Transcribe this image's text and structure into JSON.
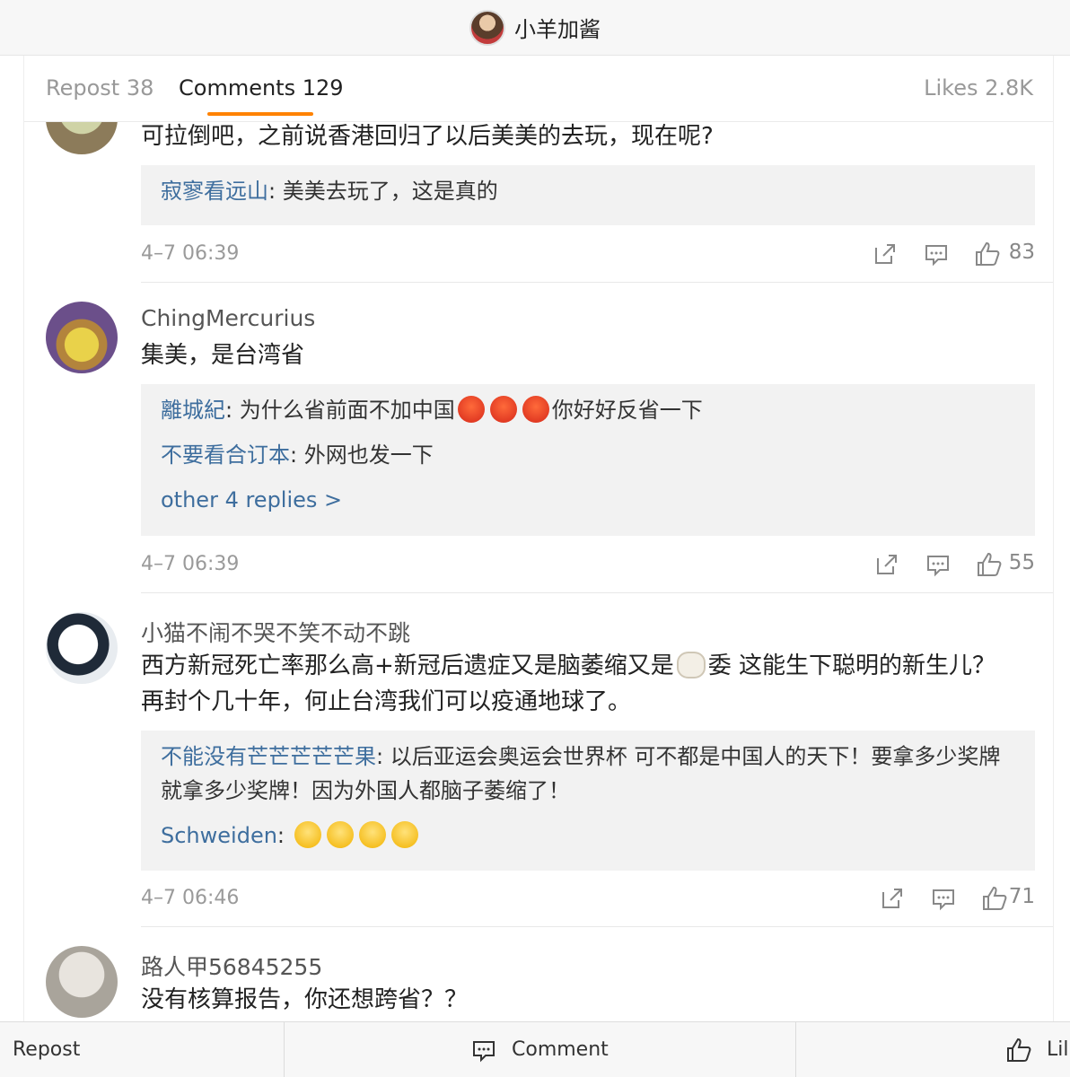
{
  "header": {
    "account_name": "小羊加酱"
  },
  "tabs": {
    "repost": "Repost 38",
    "comments": "Comments 129",
    "likes": "Likes 2.8K"
  },
  "comments": [
    {
      "text": "可拉倒吧，之前说香港回归了以后美美的去玩，现在呢?",
      "replies": [
        {
          "user": "寂寥看远山",
          "sep": ": ",
          "text": "美美去玩了，这是真的"
        }
      ],
      "time": "4–7 06:39",
      "likes": "83"
    },
    {
      "user": "ChingMercurius",
      "text": "集美，是台湾省",
      "replies": [
        {
          "user": "離城紀",
          "sep": ": ",
          "text_a": "为什么省前面不加中国",
          "text_b": "你好好反省一下"
        },
        {
          "user": "不要看合订本",
          "sep": ": ",
          "text": "外网也发一下"
        }
      ],
      "more_replies": "other 4 replies >",
      "time": "4–7 06:39",
      "likes": "55"
    },
    {
      "user": "小猫不闹不哭不笑不动不跳",
      "text_a": "西方新冠死亡率那么高+新冠后遗症又是脑萎缩又是",
      "text_b": "委 这能生下聪明的新生儿？再封个几十年，何止台湾我们可以疫通地球了。",
      "replies": [
        {
          "user": "不能没有芒芒芒芒芒果",
          "sep": ": ",
          "text": "以后亚运会奥运会世界杯 可不都是中国人的天下！要拿多少奖牌就拿多少奖牌！因为外国人都脑子萎缩了！"
        },
        {
          "user": "Schweiden",
          "sep": ": "
        }
      ],
      "time": "4–7 06:46",
      "likes": "71"
    },
    {
      "user": "路人甲56845255",
      "text": "没有核算报告，你还想跨省？？"
    }
  ],
  "bottom_bar": {
    "repost": "Repost",
    "comment": "Comment",
    "like": "Lil"
  },
  "icons": [
    "share-icon",
    "comment-icon",
    "thumbs-up-icon",
    "angry-emoji-icon",
    "laugh-cry-emoji-icon",
    "sheep-emoji-icon"
  ],
  "colors": {
    "accent": "#ff8200",
    "link": "#3e6e9e",
    "reply_bg": "#f2f2f2"
  }
}
